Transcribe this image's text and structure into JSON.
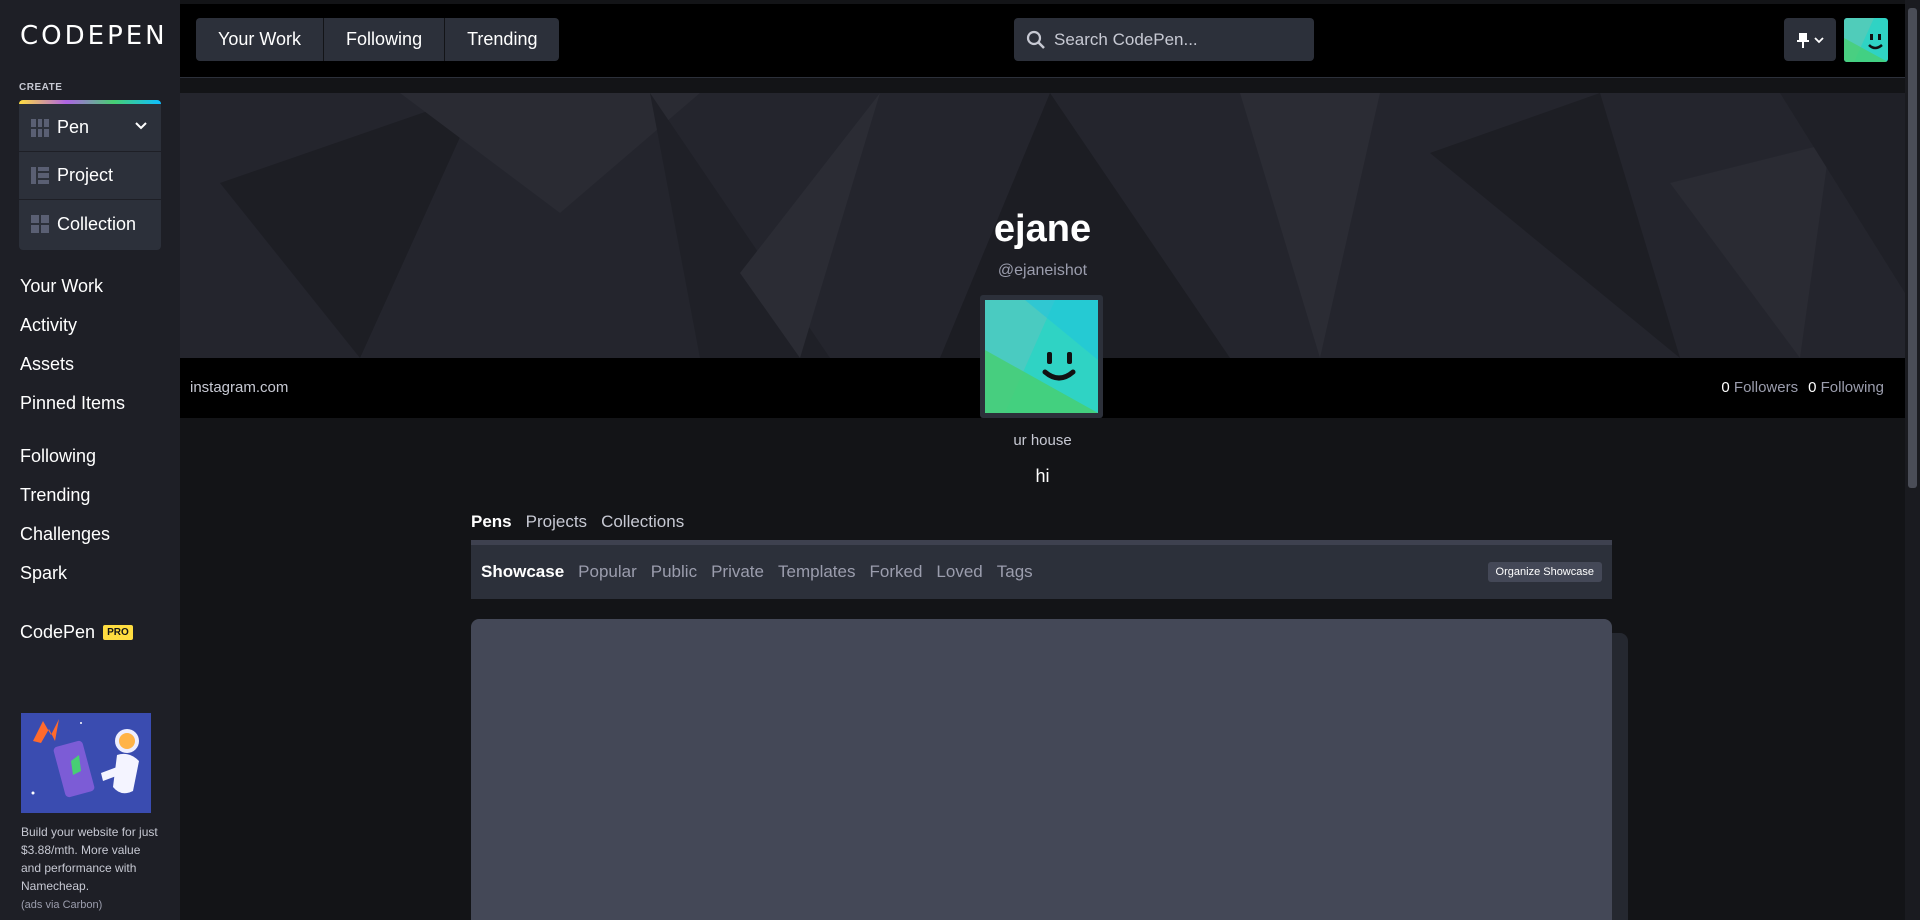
{
  "brand": {
    "logo_text": "CODEPEN"
  },
  "sidebar": {
    "create_label": "CREATE",
    "create_items": [
      {
        "label": "Pen"
      },
      {
        "label": "Project"
      },
      {
        "label": "Collection"
      }
    ],
    "nav_primary": [
      {
        "label": "Your Work"
      },
      {
        "label": "Activity"
      },
      {
        "label": "Assets"
      },
      {
        "label": "Pinned Items"
      }
    ],
    "nav_secondary": [
      {
        "label": "Following"
      },
      {
        "label": "Trending"
      },
      {
        "label": "Challenges"
      },
      {
        "label": "Spark"
      }
    ],
    "pro": {
      "label": "CodePen",
      "badge": "PRO"
    },
    "ad": {
      "text": "Build your website for just $3.88/mth. More value and performance with Namecheap.",
      "via": "(ads via Carbon)"
    }
  },
  "header": {
    "tabs": [
      {
        "label": "Your Work"
      },
      {
        "label": "Following"
      },
      {
        "label": "Trending"
      }
    ],
    "search": {
      "placeholder": "Search CodePen..."
    }
  },
  "profile": {
    "name": "ejane",
    "handle": "@ejaneishot",
    "website": "instagram.com",
    "followers": {
      "count": "0",
      "label": "Followers"
    },
    "following": {
      "count": "0",
      "label": "Following"
    },
    "location": "ur house",
    "bio": "hi"
  },
  "content": {
    "tabs": [
      {
        "label": "Pens"
      },
      {
        "label": "Projects"
      },
      {
        "label": "Collections"
      }
    ],
    "subtabs": [
      {
        "label": "Showcase"
      },
      {
        "label": "Popular"
      },
      {
        "label": "Public"
      },
      {
        "label": "Private"
      },
      {
        "label": "Templates"
      },
      {
        "label": "Forked"
      },
      {
        "label": "Loved"
      },
      {
        "label": "Tags"
      }
    ],
    "organize_label": "Organize Showcase"
  },
  "colors": {
    "background": "#131417",
    "sidebar": "#1e1f26",
    "panel": "#2c303a",
    "pro_badge": "#ffdd40",
    "avatar_teal": "#2fd3c4",
    "avatar_green": "#47cf73"
  }
}
